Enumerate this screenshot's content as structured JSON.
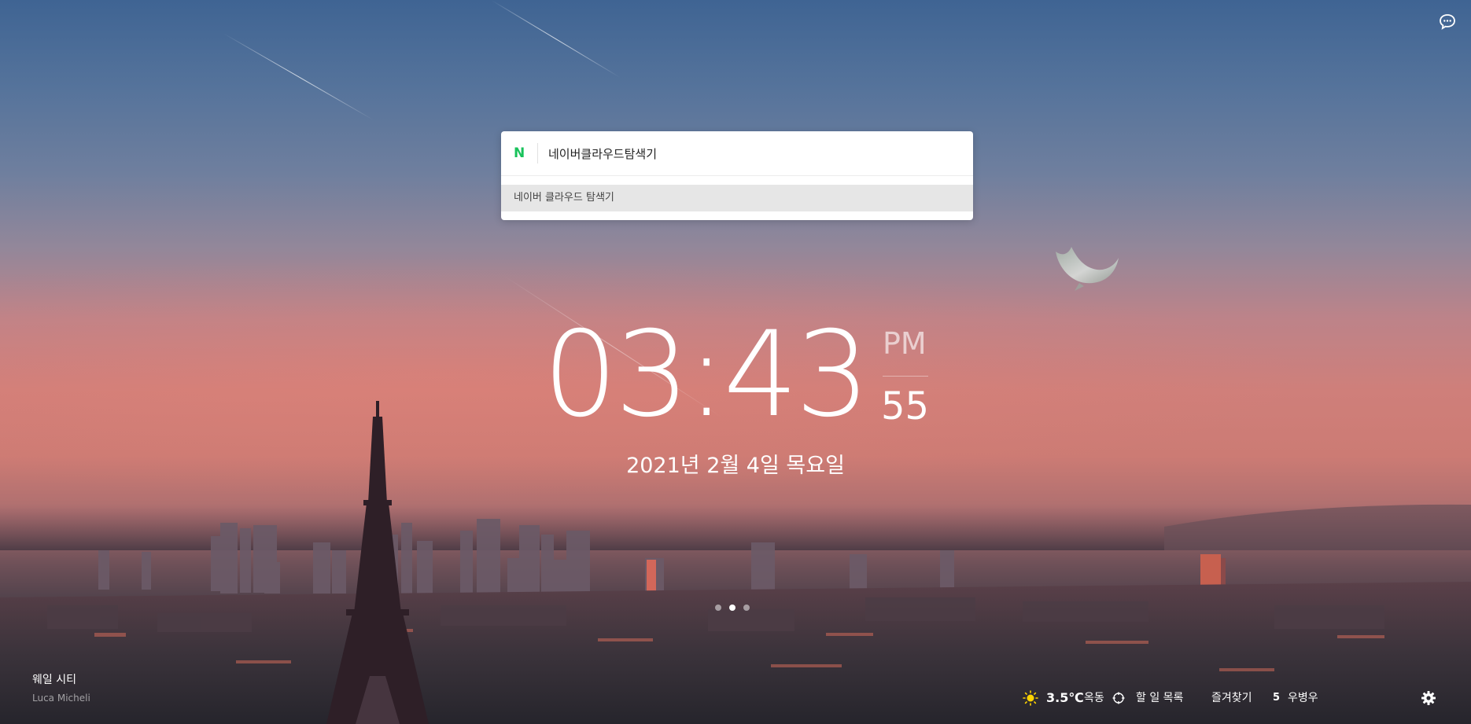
{
  "search": {
    "value": "네이버클라우드탐색기",
    "suggestion": "네이버 클라우드 탐색기",
    "engine_icon": "naver-logo-icon",
    "engine_glyph": "N",
    "engine_color": "#19c25b"
  },
  "clock": {
    "time": "03:43",
    "ampm": "PM",
    "seconds": "55"
  },
  "date": "2021년 2월 4일 목요일",
  "background_credit": {
    "title": "웨일 시티",
    "author": "Luca Micheli"
  },
  "slides": {
    "count": 3,
    "active_index": 1
  },
  "bottom_bar": {
    "weather_icon": "sun-icon",
    "temperature": "3.5℃",
    "location": "옥동",
    "todo_icon": "target-icon",
    "todo_label": "할 일 목록",
    "bookmarks_label": "즐겨찾기",
    "mail_count": "5",
    "mail_label": "우병우",
    "settings_icon": "gear-icon"
  },
  "top_right": {
    "feedback_icon": "chat-bubble-icon"
  }
}
